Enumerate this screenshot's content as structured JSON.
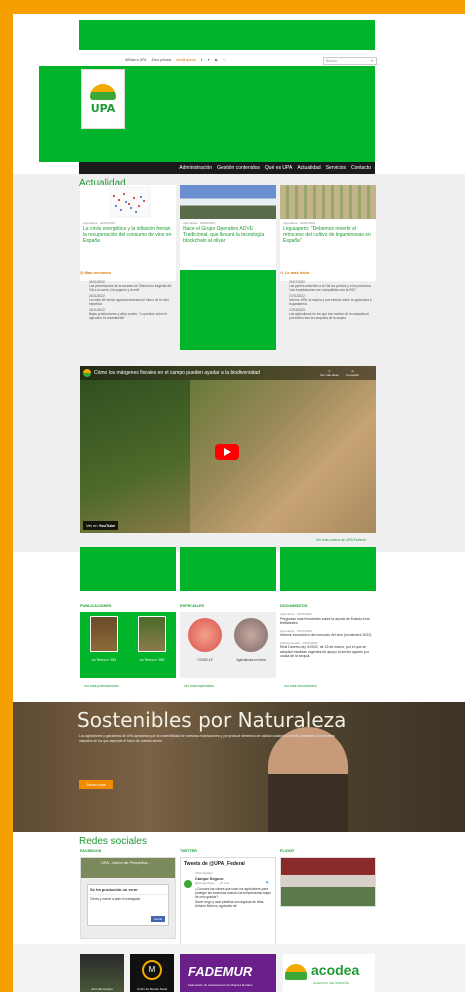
{
  "header": {
    "utility_links": [
      "Afíliate a UPA",
      "Área privada",
      "info@upa.es"
    ],
    "search_placeholder": "Buscar",
    "logo_text": "UPA",
    "nav": [
      "Administración",
      "Gestión contenidos",
      "Qué es UPA",
      "Actualidad",
      "Servicios",
      "Contacto"
    ]
  },
  "actualidad": {
    "title": "Actualidad",
    "cards": [
      {
        "category": "Agricultura · 24/01/2023",
        "title": "La crisis energética y la inflación frenan la recuperación del consumo de vino en España"
      },
      {
        "category": "Agricultura · 24/01/2023",
        "title": "Nace el Grupo Operativo ADVE Tradicional, que llevará la tecnología blockchain al olivar"
      },
      {
        "category": "Agricultura · 24/01/2023",
        "title": "Leguiapero: \"Debemos revertir el retroceso del cultivo de leguminosas en España\""
      }
    ],
    "recent_title": "Más recientes",
    "recent": [
      {
        "date": "24/11/2022",
        "text": "Las perversiones de la escasez de Sistema la tragedia del IVA a la carne, los yogures y la miel"
      },
      {
        "date": "24/11/2022",
        "text": "La crisis del sector agrícola amenaza el futuro de la miel española"
      },
      {
        "date": "24/11/2022",
        "text": "Bajas producciones y altos costes: \"La presión sobre el agricultor es insostenible\""
      }
    ],
    "read_title": "Lo más leído",
    "read": [
      {
        "date": "21/07/2022",
        "text": "Las pymes advierten a la Ola los precios y a los preciosos 'Las explotaciones son compatibles con la PAC'"
      },
      {
        "date": "17/11/2022",
        "text": "Informe UPA: la sequía y sus efectos sobre la agricultura y la ganadería"
      },
      {
        "date": "17/03/2023",
        "text": "Las agricultoras en los que son mediar de la campaña al pronóstico tras la conquista de la sequía"
      }
    ]
  },
  "video": {
    "title": "Cómo los márgenes florales en el campo pueden ayudar a la biodiversidad",
    "watch_later": "Ver más tarde",
    "share": "Compartir",
    "watch_on": "Ver en",
    "youtube": "YouTube",
    "more_link": "Ver más vídeos de UPA Federal"
  },
  "lower": {
    "pub_head": "PUBLICACIONES",
    "pubs": [
      "La Tierra nº 281",
      "La Tierra nº 280"
    ],
    "pub_link": "ver más publicaciones",
    "esp_head": "ESPECIALES",
    "esps": [
      "COVID-19",
      "Agricultoras en línea"
    ],
    "esp_link": "ver más especiales",
    "doc_head": "DOCUMENTOS",
    "docs": [
      {
        "meta": "Agricultura · 15/07/2022",
        "title": "Preguntas más frecuentes sobre la ayuda de Estado a los fertilizantes"
      },
      {
        "meta": "Agricultura · 15/07/2022",
        "title": "Informe económico del mercado del vino (noviembre 2022)"
      },
      {
        "meta": "Política agraria · 15/07/2022",
        "title": "Real Decreto-ley 4/2022, de 15 de marzo, por el que se adoptan medidas urgentes de apoyo al sector agrario por causa de la sequía."
      }
    ],
    "doc_link": "ver más documentos"
  },
  "banner": {
    "title": "Sostenibles por Naturaleza",
    "body": "Los agricultores y ganaderos de UPA apostamos por la sostenibilidad de nuestras explotaciones y por producir alimentos de calidad cuidando el medio ambiente y los recursos naturales de los que depende el futuro de nuestro sector.",
    "button": "Saber más"
  },
  "social": {
    "title": "Redes sociales",
    "fb_head": "FACEBOOK",
    "fb_page": "UPA - Unión de Pequeños...",
    "fb_error_title": "Se ha producido un error",
    "fb_error_text": "Cierra y vuelve a abrir el navegador",
    "fb_close": "Cerrar",
    "tw_head": "TWITTER",
    "tw_title": "Tweets de @UPA_Federal",
    "tw_retweet": "UPA retwitteó",
    "tw_user": "Campo Seguro",
    "tw_handle": "@CampoSegu... · 20 ene.",
    "tw_text": "¿Conoces las claves que usan los agricultores para proteger las cosechas cuando las temperaturas bajan de cero grados?",
    "tw_text2": "Hacer riego y usar parafina son algunas de ellas. Antonio Moreno, agricultor de",
    "flickr_head": "FLICKR"
  },
  "partners": [
    "Arco del Campo",
    "Unión de Mundo Rural",
    "FADEMUR",
    "acodea"
  ],
  "partner_sub": {
    "fademur": "Federación de Asociaciones de Mujeres Rurales",
    "acodea": "AGENCIA DE ESPAÑA"
  }
}
